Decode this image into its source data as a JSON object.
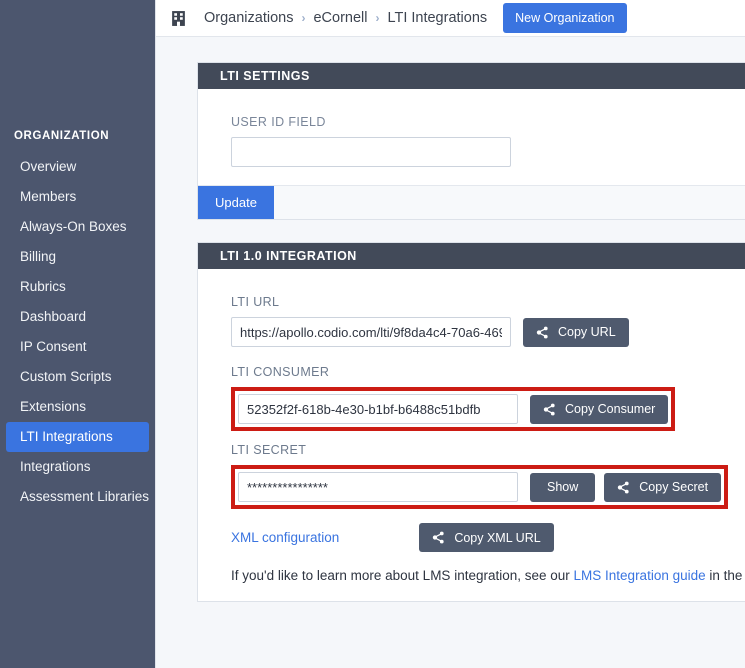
{
  "sidebar": {
    "heading": "ORGANIZATION",
    "items": [
      {
        "label": "Overview",
        "active": false
      },
      {
        "label": "Members",
        "active": false
      },
      {
        "label": "Always-On Boxes",
        "active": false
      },
      {
        "label": "Billing",
        "active": false
      },
      {
        "label": "Rubrics",
        "active": false
      },
      {
        "label": "Dashboard",
        "active": false
      },
      {
        "label": "IP Consent",
        "active": false
      },
      {
        "label": "Custom Scripts",
        "active": false
      },
      {
        "label": "Extensions",
        "active": false
      },
      {
        "label": "LTI Integrations",
        "active": true
      },
      {
        "label": "Integrations",
        "active": false
      },
      {
        "label": "Assessment Libraries",
        "active": false
      }
    ]
  },
  "topbar": {
    "icon": "building-icon",
    "breadcrumb": [
      "Organizations",
      "eCornell",
      "LTI Integrations"
    ],
    "separator": "›",
    "new_org_label": "New Organization"
  },
  "settings_panel": {
    "title": "LTI SETTINGS",
    "user_id_field_label": "USER ID FIELD",
    "user_id_field_value": "",
    "user_id_field_placeholder": "",
    "update_label": "Update"
  },
  "lti_panel": {
    "title": "LTI 1.0 INTEGRATION",
    "url_label": "LTI URL",
    "url_value": "https://apollo.codio.com/lti/9f8da4c4-70a6-469",
    "copy_url_label": "Copy URL",
    "consumer_label": "LTI CONSUMER",
    "consumer_value": "52352f2f-618b-4e30-b1bf-b6488c51bdfb",
    "copy_consumer_label": "Copy Consumer",
    "secret_label": "LTI SECRET",
    "secret_value": "****************",
    "show_label": "Show",
    "copy_secret_label": "Copy Secret",
    "xml_config_label": "XML configuration",
    "copy_xml_label": "Copy XML URL",
    "footer_text_before": "If you'd like to learn more about LMS integration, see our ",
    "footer_link": "LMS Integration guide",
    "footer_text_after": " in the docs."
  },
  "colors": {
    "sidebar_bg": "#4c566e",
    "accent_blue": "#3a74e0",
    "panel_header": "#424a59",
    "button_grey": "#4f5a6e",
    "highlight_red": "#cc1c14",
    "page_bg": "#f5f7fa"
  }
}
